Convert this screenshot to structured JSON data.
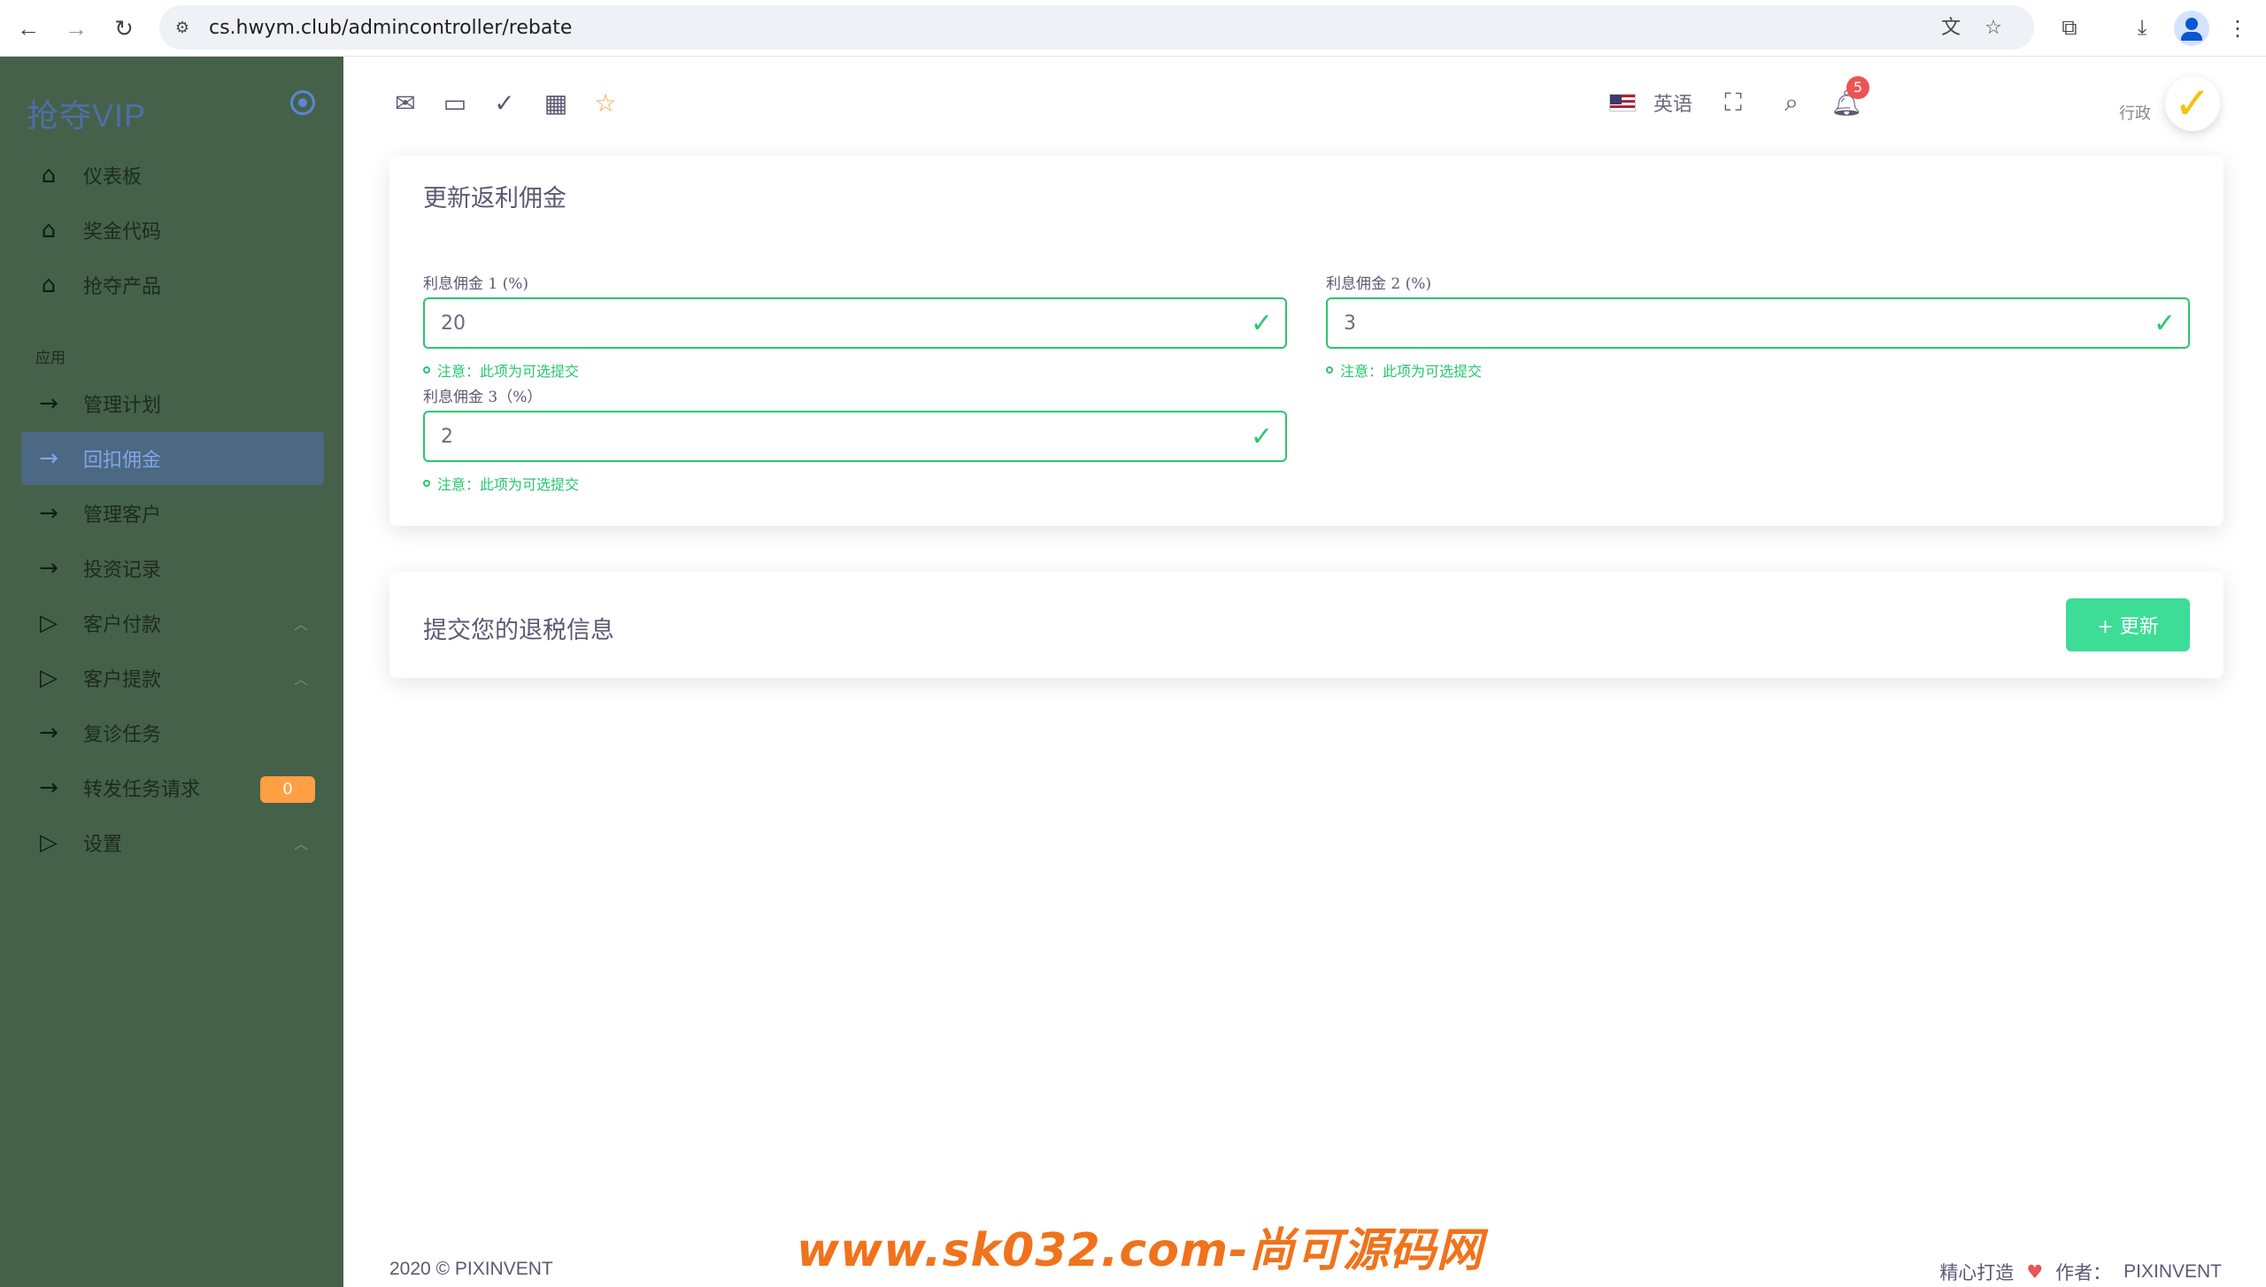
{
  "browser": {
    "url": "cs.hwym.club/admincontroller/rebate"
  },
  "sidebar": {
    "brand": "抢夺VIP",
    "items_top": [
      {
        "label": "仪表板"
      },
      {
        "label": "奖金代码"
      },
      {
        "label": "抢夺产品"
      }
    ],
    "section_label": "应用",
    "items_app": [
      {
        "label": "管理计划"
      },
      {
        "label": "回扣佣金"
      },
      {
        "label": "管理客户"
      },
      {
        "label": "投资记录"
      },
      {
        "label": "客户付款"
      },
      {
        "label": "客户提款"
      },
      {
        "label": "复诊任务"
      },
      {
        "label": "转发任务请求",
        "badge": "0"
      },
      {
        "label": "设置"
      }
    ]
  },
  "navbar": {
    "language": "英语",
    "notification_count": "5",
    "user_role": "行政"
  },
  "form_card": {
    "title": "更新返利佣金",
    "fields": [
      {
        "label": "利息佣金 1 (%)",
        "value": "20",
        "hint": "注意：此项为可选提交"
      },
      {
        "label": "利息佣金 2 (%)",
        "value": "3",
        "hint": "注意：此项为可选提交"
      },
      {
        "label": "利息佣金 3（%）",
        "value": "2",
        "hint": "注意：此项为可选提交"
      }
    ]
  },
  "submit_card": {
    "title": "提交您的退税信息",
    "button": "+ 更新"
  },
  "footer": {
    "copyright": "2020 © PIXINVENT",
    "made_with": "精心打造",
    "author_label": "作者：",
    "author": "PIXINVENT",
    "watermark": "www.sk032.com-尚可源码网"
  },
  "colors": {
    "sidebar_bg": "#45614a",
    "active_item_bg": "#4c6882",
    "success": "#28c76f",
    "button": "#3ddc97",
    "warning_badge": "#ff9f43",
    "danger_badge": "#ea5455"
  }
}
